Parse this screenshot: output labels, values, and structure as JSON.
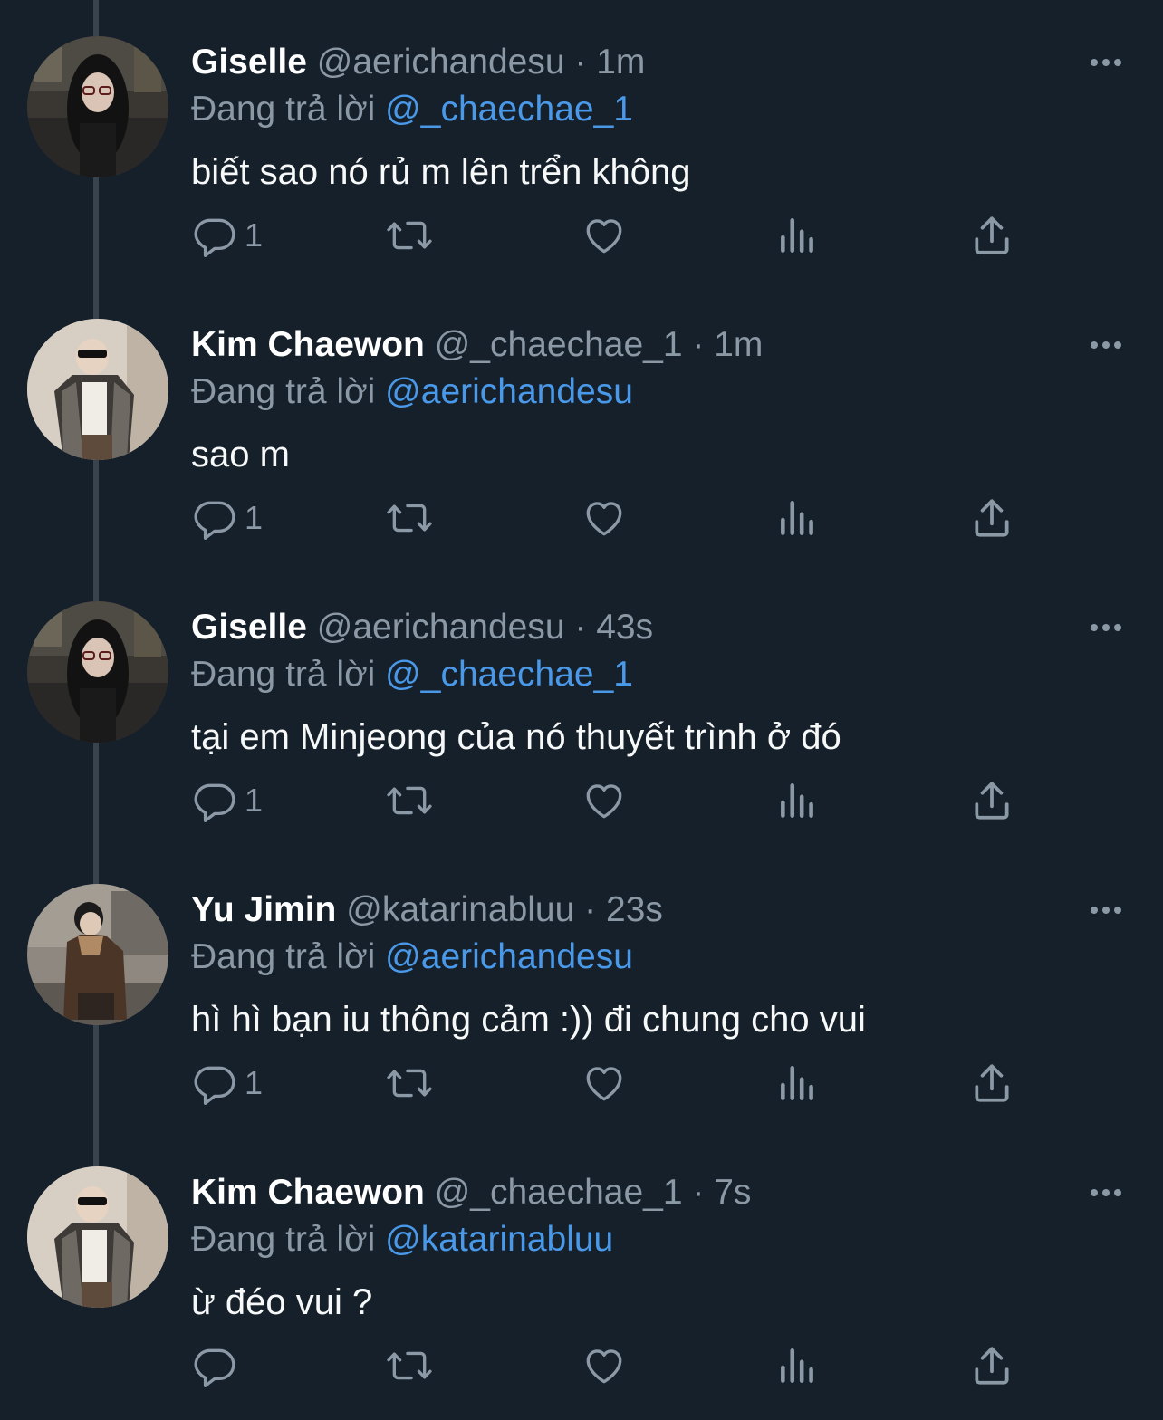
{
  "reply_prefix": "Đang trả lời",
  "colors": {
    "background": "#15202b",
    "secondary_text": "#8b98a5",
    "mention": "#4a99e9",
    "thread_line": "#38444d"
  },
  "tweets": [
    {
      "name": "Giselle",
      "handle": "@aerichandesu",
      "sep": "·",
      "time": "1m",
      "reply_to": "@_chaechae_1",
      "text": "biết sao nó rủ m lên trển không",
      "reply_count": "1",
      "avatar": "giselle-avatar"
    },
    {
      "name": "Kim Chaewon",
      "handle": "@_chaechae_1",
      "sep": "·",
      "time": "1m",
      "reply_to": "@aerichandesu",
      "text": "sao m",
      "reply_count": "1",
      "avatar": "chaewon-avatar"
    },
    {
      "name": "Giselle",
      "handle": "@aerichandesu",
      "sep": "·",
      "time": "43s",
      "reply_to": "@_chaechae_1",
      "text": "tại em Minjeong của nó thuyết trình ở đó",
      "reply_count": "1",
      "avatar": "giselle-avatar"
    },
    {
      "name": "Yu Jimin",
      "handle": "@katarinabluu",
      "sep": "·",
      "time": "23s",
      "reply_to": "@aerichandesu",
      "text": "hì hì bạn iu thông cảm :)) đi chung cho vui",
      "reply_count": "1",
      "avatar": "jimin-avatar"
    },
    {
      "name": "Kim Chaewon",
      "handle": "@_chaechae_1",
      "sep": "·",
      "time": "7s",
      "reply_to": "@katarinabluu",
      "text": "ừ đéo vui ?",
      "reply_count": "",
      "avatar": "chaewon-avatar"
    }
  ]
}
